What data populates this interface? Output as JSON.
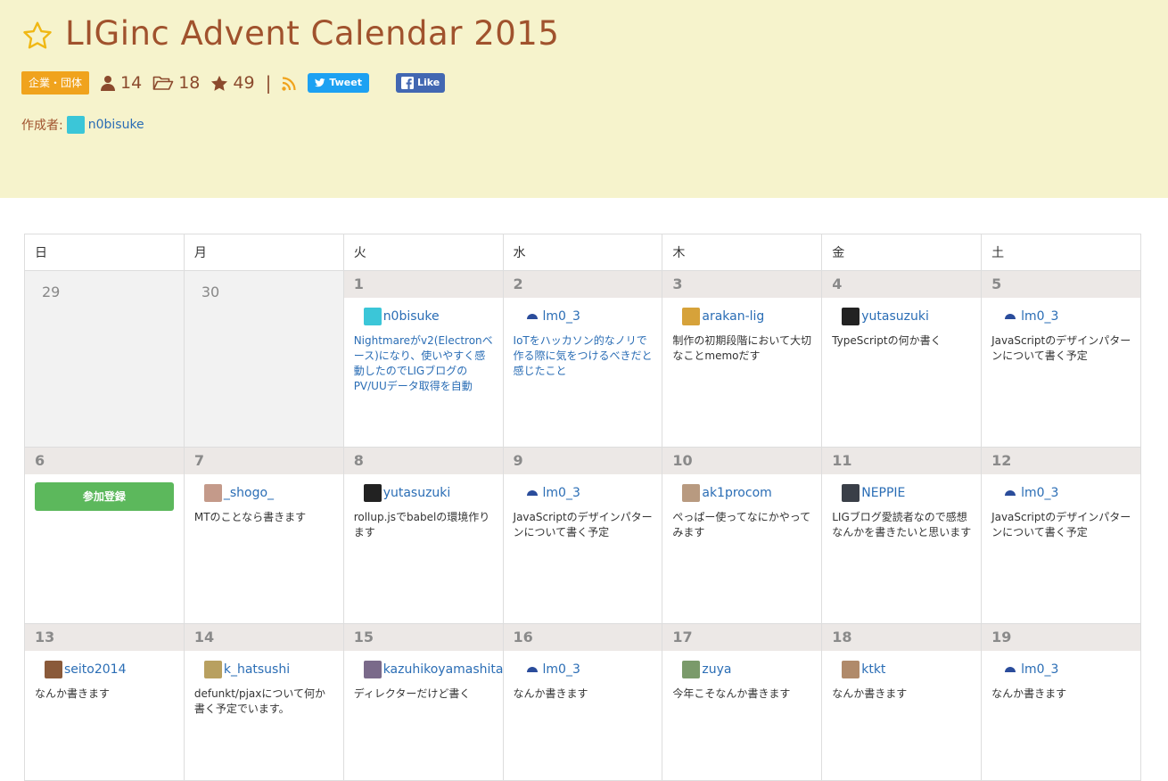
{
  "header": {
    "title": "LIGinc Advent Calendar 2015",
    "badge": "企業・団体",
    "participants": "14",
    "folders": "18",
    "stars": "49",
    "separator": "|",
    "tweet_label": "Tweet",
    "like_label": "Like",
    "author_label": "作成者:",
    "author_name": "n0bisuke"
  },
  "calendar": {
    "weekdays": [
      "日",
      "月",
      "火",
      "水",
      "木",
      "金",
      "土"
    ],
    "join_label": "参加登録",
    "weeks": [
      [
        {
          "day": "29",
          "off": true
        },
        {
          "day": "30",
          "off": true
        },
        {
          "day": "1",
          "user": "n0bisuke",
          "text": "Nightmareがv2(Electronベース)になり、使いやすく感動したのでLIGブログのPV/UUデータ取得を自動",
          "link": true,
          "avatar": "#3bc6d8"
        },
        {
          "day": "2",
          "user": "lm0_3",
          "text": "IoTをハッカソン的なノリで作る際に気をつけるべきだと感じたこと",
          "link": true,
          "avatar": "#2a4c9b"
        },
        {
          "day": "3",
          "user": "arakan-lig",
          "text": "制作の初期段階において大切なことmemoだす",
          "link": false,
          "avatar": "#d6a23a"
        },
        {
          "day": "4",
          "user": "yutasuzuki",
          "text": "TypeScriptの何か書く",
          "link": false,
          "avatar": "#222222"
        },
        {
          "day": "5",
          "user": "lm0_3",
          "text": "JavaScriptのデザインパターンについて書く予定",
          "link": false,
          "avatar": "#2a4c9b"
        }
      ],
      [
        {
          "day": "6",
          "join": true
        },
        {
          "day": "7",
          "user": "_shogo_",
          "text": "MTのことなら書きます",
          "link": false,
          "avatar": "#c49a8a"
        },
        {
          "day": "8",
          "user": "yutasuzuki",
          "text": "rollup.jsでbabelの環境作ります",
          "link": false,
          "avatar": "#222222"
        },
        {
          "day": "9",
          "user": "lm0_3",
          "text": "JavaScriptのデザインパターンについて書く予定",
          "link": false,
          "avatar": "#2a4c9b"
        },
        {
          "day": "10",
          "user": "ak1procom",
          "text": "ぺっぱー使ってなにかやってみます",
          "link": false,
          "avatar": "#b89a80"
        },
        {
          "day": "11",
          "user": "NEPPIE",
          "text": "LIGブログ愛読者なので感想なんかを書きたいと思います",
          "link": false,
          "avatar": "#3a3f48"
        },
        {
          "day": "12",
          "user": "lm0_3",
          "text": "JavaScriptのデザインパターンについて書く予定",
          "link": false,
          "avatar": "#2a4c9b"
        }
      ],
      [
        {
          "day": "13",
          "user": "seito2014",
          "text": "なんか書きます",
          "link": false,
          "avatar": "#8a5a3a"
        },
        {
          "day": "14",
          "user": "k_hatsushi",
          "text": "defunkt/pjaxについて何か書く予定でいます。",
          "link": false,
          "avatar": "#b8a060"
        },
        {
          "day": "15",
          "user": "kazuhikoyamashita",
          "text": "ディレクターだけど書く",
          "link": false,
          "avatar": "#7a6a8a"
        },
        {
          "day": "16",
          "user": "lm0_3",
          "text": "なんか書きます",
          "link": false,
          "avatar": "#2a4c9b"
        },
        {
          "day": "17",
          "user": "zuya",
          "text": "今年こそなんか書きます",
          "link": false,
          "avatar": "#7a9a6a"
        },
        {
          "day": "18",
          "user": "ktkt",
          "text": "なんか書きます",
          "link": false,
          "avatar": "#b08a6a"
        },
        {
          "day": "19",
          "user": "lm0_3",
          "text": "なんか書きます",
          "link": false,
          "avatar": "#2a4c9b"
        }
      ]
    ]
  }
}
